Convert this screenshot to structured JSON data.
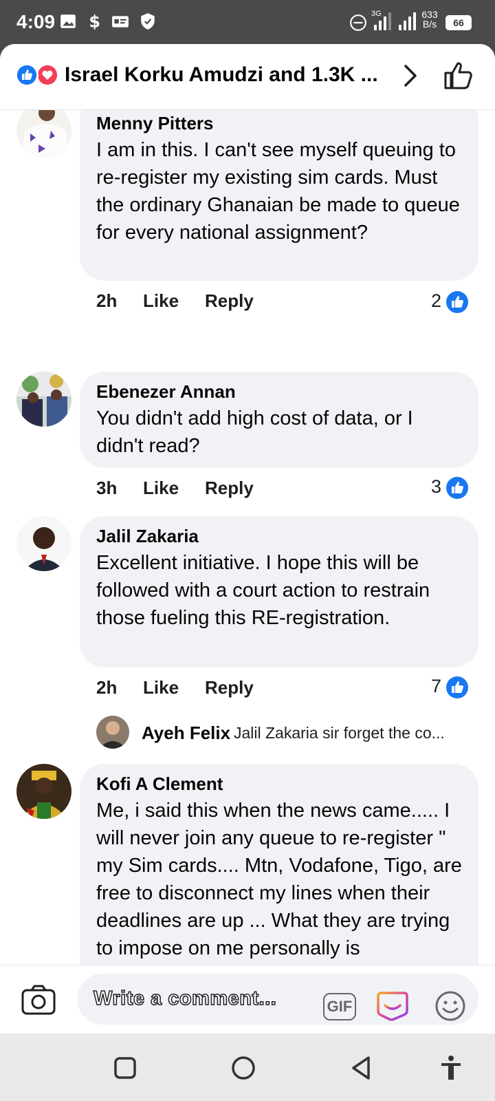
{
  "status_bar": {
    "time": "4:09",
    "net_speed_top": "633",
    "net_speed_bottom": "B/s",
    "battery": "66",
    "network_label": "3G"
  },
  "header": {
    "title": "Israel Korku Amudzi and 1.3K ..."
  },
  "comments": [
    {
      "author": "Menny Pitters",
      "text": "I am in this. I can't see myself queuing to re-register my existing sim cards. Must the ordinary Ghanaian be made to queue for every national assignment?",
      "time": "2h",
      "like_label": "Like",
      "reply_label": "Reply",
      "likes": "2"
    },
    {
      "author": "Ebenezer Annan",
      "text": "You didn't add high cost of data, or I didn't read?",
      "time": "3h",
      "like_label": "Like",
      "reply_label": "Reply",
      "likes": "3"
    },
    {
      "author": "Jalil Zakaria",
      "text": "Excellent initiative. I hope this will be followed with a court action to restrain those fueling this RE-registration.",
      "time": "2h",
      "like_label": "Like",
      "reply_label": "Reply",
      "likes": "7",
      "reply_preview": {
        "author": "Ayeh Felix",
        "text": "Jalil Zakaria sir forget the co..."
      }
    },
    {
      "author": "Kofi A Clement",
      "text": "Me, i said this when the news came..... I will never join any queue to re-register \" my Sim cards.... Mtn, Vodafone, Tigo, are free to disconnect my lines when their deadlines are up ... What they are trying to impose on me personally is"
    }
  ],
  "composer": {
    "placeholder": "Write a comment...",
    "gif_label": "GIF"
  },
  "colors": {
    "facebook_blue": "#1877f2",
    "bubble_bg": "#f0f2f5",
    "love_red": "#f33e58"
  },
  "icons": {
    "header": [
      "like-reaction-icon",
      "love-reaction-icon",
      "chevron-right-icon",
      "thumbs-up-outline-icon"
    ],
    "composer": [
      "camera-icon",
      "gif-icon",
      "avatar-sticker-icon",
      "emoji-icon"
    ],
    "navbar": [
      "recents-square-icon",
      "home-circle-icon",
      "back-triangle-icon",
      "accessibility-icon"
    ]
  }
}
